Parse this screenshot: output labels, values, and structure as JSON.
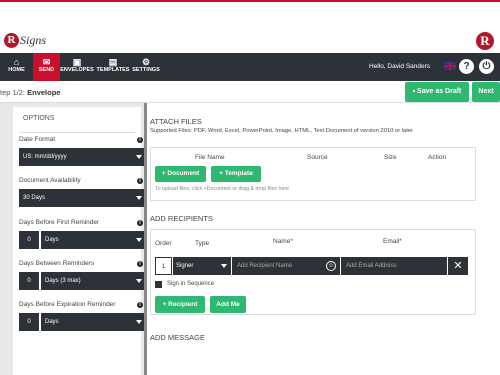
{
  "logo": {
    "text": "Signs",
    "mark": "R"
  },
  "nav": {
    "items": [
      {
        "label": "HOME",
        "icon": "⌂"
      },
      {
        "label": "SEND",
        "icon": "✉"
      },
      {
        "label": "ENVELOPES",
        "icon": "▣"
      },
      {
        "label": "TEMPLATES",
        "icon": "▤"
      },
      {
        "label": "SETTINGS",
        "icon": "⚙"
      }
    ],
    "greeting": "Hello, David Sanders",
    "help": "?",
    "power": "⏻"
  },
  "subheader": {
    "step_prefix": "tep 1/2: ",
    "step_name": "Envelope",
    "save_draft": "Save as Draft",
    "next": "Next"
  },
  "options": {
    "title": "OPTIONS",
    "date_format": {
      "label": "Date Format",
      "value": "US: mm/dd/yyyy"
    },
    "doc_availability": {
      "label": "Document Availability",
      "value": "30 Days"
    },
    "first_reminder": {
      "label": "Days Before First Reminder",
      "number": "0",
      "unit": "Days"
    },
    "between_reminders": {
      "label": "Days Between Reminders",
      "number": "0",
      "unit": "Days (3 max)"
    },
    "expiration_reminder": {
      "label": "Days Before Expiration Reminder",
      "number": "0",
      "unit": "Days"
    }
  },
  "attach": {
    "title": "ATTACH FILES",
    "supported": "Supported Files: PDF, Word, Excel, PowerPoint, Image, HTML, Text Document of version 2010 or later",
    "columns": [
      "File Name",
      "Source",
      "Size",
      "Action"
    ],
    "add_document": "+ Document",
    "add_template": "+ Template",
    "hint": "To upload files, click +Document or drag & drop files here"
  },
  "recipients": {
    "title": "ADD RECIPIENTS",
    "columns": {
      "order": "Order",
      "type": "Type",
      "name": "Name",
      "email": "Email",
      "required_mark": "*"
    },
    "row": {
      "order": "1",
      "type": "Signer",
      "name_placeholder": "Add Recipient Name",
      "email_placeholder": "Add Email Address"
    },
    "sign_in_sequence": "Sign in Sequence",
    "add_recipient": "+ Recipient",
    "add_me": "Add Me"
  },
  "message": {
    "title": "ADD MESSAGE"
  },
  "colors": {
    "accent": "#c8102e",
    "green": "#2eb872",
    "dark": "#2c3237"
  }
}
